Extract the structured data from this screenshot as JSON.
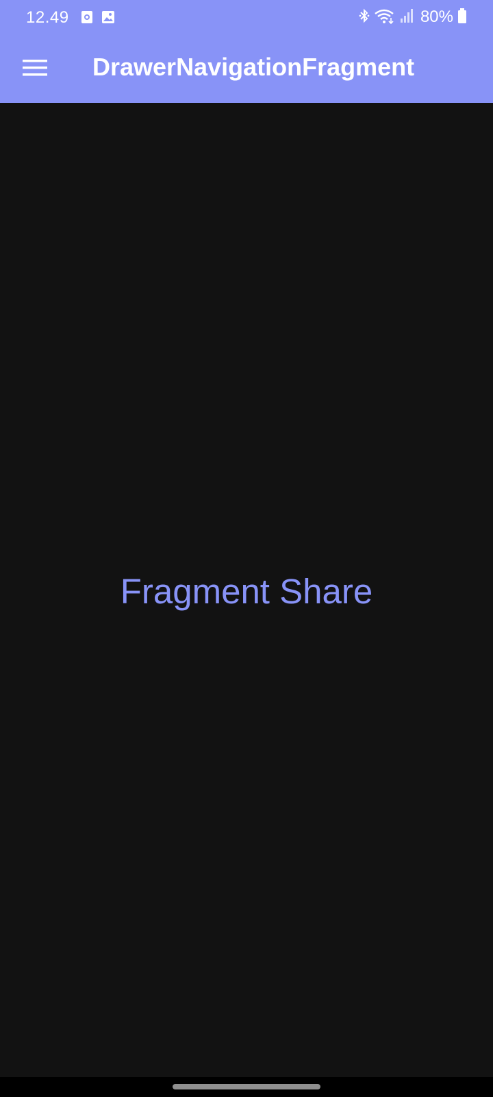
{
  "status_bar": {
    "time": "12.49",
    "battery": "80%",
    "icons": [
      "screen-record-icon",
      "image-notification-icon",
      "bluetooth-icon",
      "wifi-icon",
      "signal-icon",
      "battery-icon"
    ]
  },
  "app_bar": {
    "title": "DrawerNavigationFragment",
    "menu_icon": "menu-icon"
  },
  "content": {
    "label": "Fragment Share"
  },
  "colors": {
    "accent": "#8893f7",
    "background": "#121212",
    "nav_bar": "#000000",
    "text_on_accent": "#ffffff"
  }
}
